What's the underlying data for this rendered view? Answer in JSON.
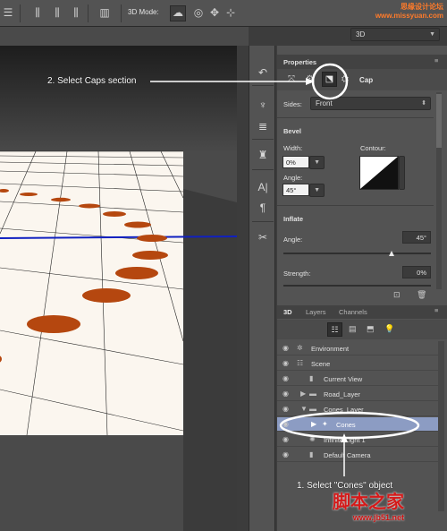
{
  "toolbar": {
    "mode_label": "3D Mode:",
    "workspace_value": "3D"
  },
  "watermark": {
    "line1": "思缘设计论坛",
    "line2": "www.missyuan.com"
  },
  "properties": {
    "title": "Properties",
    "section_label": "Cap",
    "sides_label": "Sides:",
    "sides_value": "Front",
    "bevel_heading": "Bevel",
    "width_label": "Width:",
    "width_value": "0%",
    "contour_label": "Contour:",
    "angle_label": "Angle:",
    "angle_value": "45°",
    "inflate_heading": "Inflate",
    "inflate_angle_label": "Angle:",
    "inflate_angle_value": "45°",
    "strength_label": "Strength:",
    "strength_value": "0%"
  },
  "layers_panel": {
    "tabs": [
      "3D",
      "Layers",
      "Channels"
    ],
    "rows": [
      {
        "label": "Environment",
        "icon": "environment-icon"
      },
      {
        "label": "Scene",
        "icon": "scene-icon"
      },
      {
        "label": "Current View",
        "icon": "camera-icon"
      },
      {
        "label": "Road_Layer",
        "icon": "mesh-icon"
      },
      {
        "label": "Cones_Layer",
        "icon": "mesh-icon"
      },
      {
        "label": "Cones",
        "icon": "material-icon",
        "selected": true
      },
      {
        "label": "Infinite Light 1",
        "icon": "light-icon"
      },
      {
        "label": "Default Camera",
        "icon": "camera-icon"
      }
    ]
  },
  "annotations": {
    "step2": "2. Select Caps section",
    "step1": "1. Select \"Cones\" object"
  },
  "watermark_bottom": {
    "line1": "脚本之家",
    "line2": "www.jb51.net"
  }
}
